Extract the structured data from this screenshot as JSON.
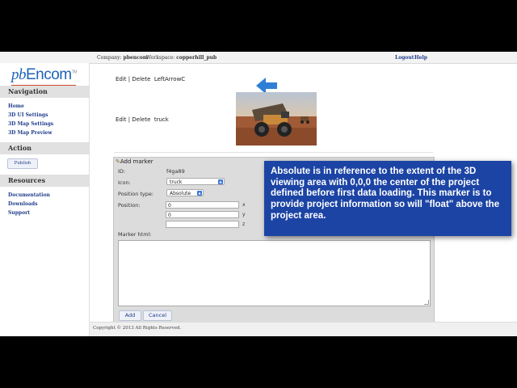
{
  "topbar": {
    "company_label": "Company:",
    "company_value": "pbencom",
    "workspace_label": "Workspace:",
    "workspace_value": "copperhill_pub",
    "logout": "Logout",
    "help": "Help"
  },
  "logo": {
    "pb": "pb",
    "encom": "Encom",
    "tm": "TM"
  },
  "sidebar": {
    "navigation_title": "Navigation",
    "nav_items": [
      "Home",
      "3D UI Settings",
      "3D Map Settings",
      "3D Map Preview"
    ],
    "action_title": "Action",
    "publish": "Publish",
    "resources_title": "Resources",
    "resource_items": [
      "Documentation",
      "Downloads",
      "Support"
    ]
  },
  "markers": [
    {
      "edit": "Edit",
      "sep": "|",
      "delete": "Delete",
      "name": "LeftArrowC",
      "icon": "left-arrow-icon"
    },
    {
      "edit": "Edit",
      "sep": "|",
      "delete": "Delete",
      "name": "truck",
      "icon": "mining-truck-image"
    }
  ],
  "dialog": {
    "title": "Add marker",
    "id_label": "ID:",
    "id_value": "f4ga89",
    "icon_label": "Icon:",
    "icon_value": "truck",
    "position_type_label": "Position type:",
    "position_type_value": "Absolute",
    "position_label": "Position:",
    "pos_x": "0",
    "pos_y": "0",
    "pos_z": "",
    "axis_x": "x",
    "axis_y": "y",
    "axis_z": "z",
    "marker_html_label": "Marker html:",
    "add": "Add",
    "cancel": "Cancel"
  },
  "footer": {
    "copyright": "Copyright © 2013 All Rights Reserved."
  },
  "callout": {
    "text": "Absolute is in reference to the extent of the 3D viewing area with 0,0,0 the center of the project defined before first data loading. This marker is to provide project information so will \"float\" above the project area."
  },
  "colors": {
    "accent": "#1f63b7",
    "callout_bg": "#1c44a5",
    "arrow": "#2f7fd6",
    "link": "#1e3c8c"
  }
}
